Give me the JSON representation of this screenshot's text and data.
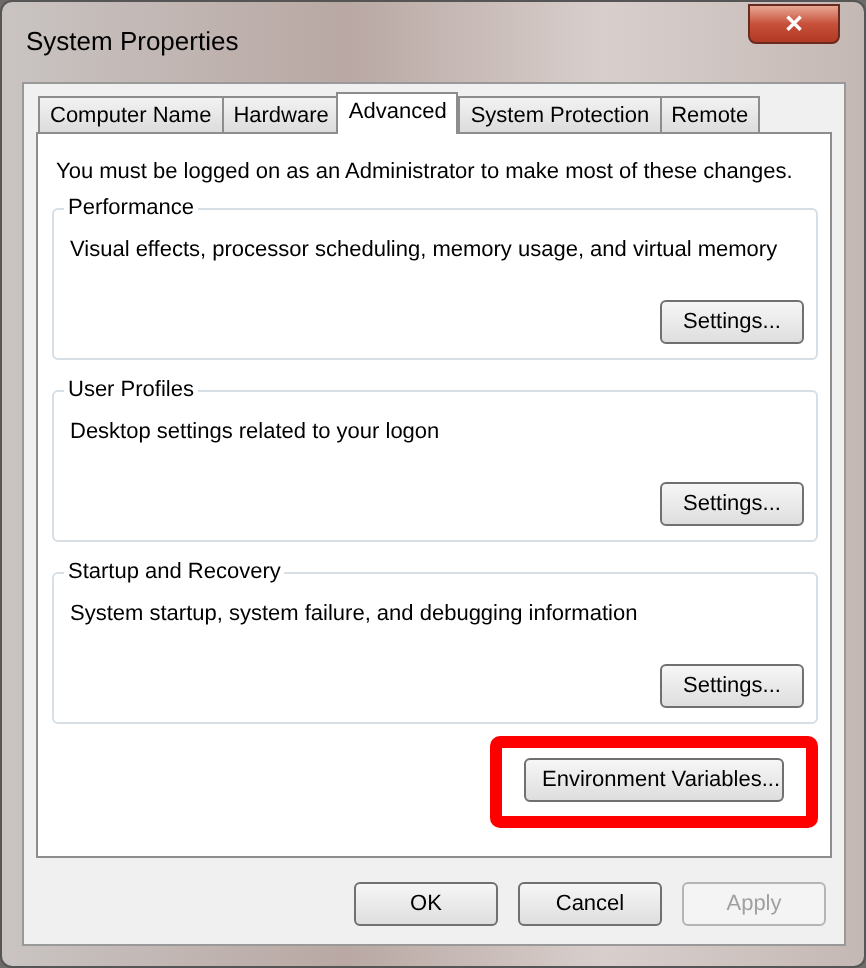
{
  "window": {
    "title": "System Properties",
    "close_glyph": "✕"
  },
  "tabs": [
    {
      "label": "Computer Name",
      "selected": false
    },
    {
      "label": "Hardware",
      "selected": false
    },
    {
      "label": "Advanced",
      "selected": true
    },
    {
      "label": "System Protection",
      "selected": false
    },
    {
      "label": "Remote",
      "selected": false
    }
  ],
  "notice": "You must be logged on as an Administrator to make most of these changes.",
  "groups": [
    {
      "title": "Performance",
      "description": "Visual effects, processor scheduling, memory usage, and virtual memory",
      "button": "Settings..."
    },
    {
      "title": "User Profiles",
      "description": "Desktop settings related to your logon",
      "button": "Settings..."
    },
    {
      "title": "Startup and Recovery",
      "description": "System startup, system failure, and debugging information",
      "button": "Settings..."
    }
  ],
  "environment_button": {
    "label": "Environment Variables...",
    "highlighted": true
  },
  "buttons": [
    {
      "label": "OK",
      "disabled": false
    },
    {
      "label": "Cancel",
      "disabled": false
    },
    {
      "label": "Apply",
      "disabled": true
    }
  ]
}
